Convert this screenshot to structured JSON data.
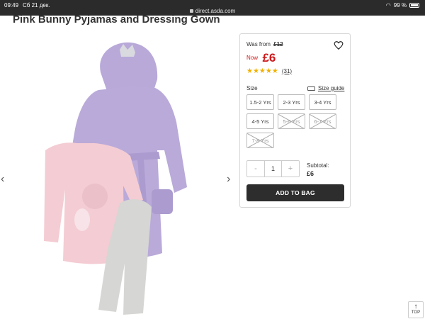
{
  "status_bar": {
    "time": "09:49",
    "date": "Сб 21 дек.",
    "url": "direct.asda.com",
    "battery": "99 %"
  },
  "product": {
    "title": "Pink Bunny Pyjamas and Dressing Gown"
  },
  "buy_panel": {
    "was_label": "Was from",
    "was_price": "£12",
    "now_label": "Now",
    "now_price": "£6",
    "rating_stars": 5,
    "stars_text": "★★★★★",
    "review_count": "(31)",
    "size_label": "Size",
    "size_guide": "Size guide",
    "sizes": [
      {
        "label": "1.5-2 Yrs",
        "available": true
      },
      {
        "label": "2-3 Yrs",
        "available": true
      },
      {
        "label": "3-4 Yrs",
        "available": true
      },
      {
        "label": "4-5 Yrs",
        "available": true
      },
      {
        "label": "5-6 Yrs",
        "available": false
      },
      {
        "label": "6-7 Yrs",
        "available": false
      },
      {
        "label": "7-8 Yrs",
        "available": false
      }
    ],
    "quantity": "1",
    "minus": "-",
    "plus": "+",
    "subtotal_label": "Subtotal:",
    "subtotal_value": "£6",
    "add_to_bag": "ADD TO BAG"
  },
  "nav": {
    "prev": "‹",
    "next": "›",
    "top_label": "TOP"
  },
  "colors": {
    "price_red": "#d0181a",
    "star_gold": "#f2b000",
    "button_dark": "#2d2d2d"
  }
}
